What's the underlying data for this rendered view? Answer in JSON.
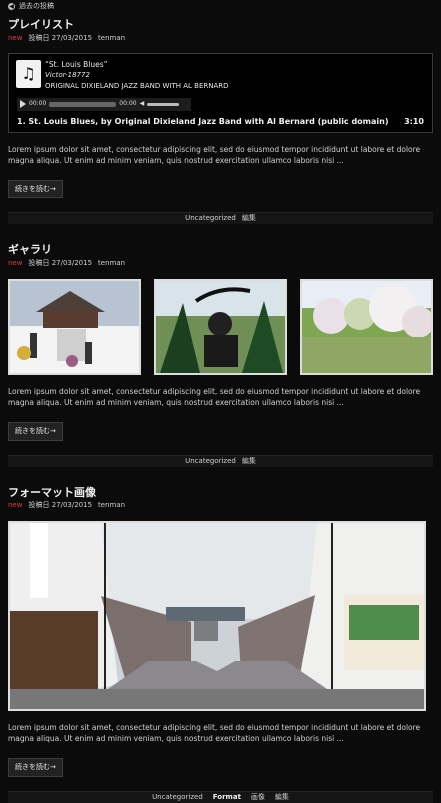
{
  "top": {
    "label": "過去の投稿"
  },
  "posts": [
    {
      "title": "プレイリスト",
      "new": "new",
      "date": "投稿日 27/03/2015",
      "author": "tenman",
      "playlist": {
        "title": "“St. Louis Blues”",
        "artist": "Victor-18772",
        "album": "ORIGINAL DIXIELAND JAZZ BAND WITH AL BERNARD",
        "time_current": "00:00",
        "time_total": "00:00",
        "track_line": "1. St. Louis Blues, by Original Dixieland Jazz Band with Al Bernard (public domain)",
        "duration": "3:10"
      },
      "excerpt": "Lorem ipsum dolor sit amet, consectetur adipiscing elit, sed do eiusmod tempor incididunt ut labore et dolore magna aliqua. Ut enim ad minim veniam, quis nostrud exercitation ullamco laboris nisi ...",
      "readmore": "続きを読む→",
      "category": "Uncategorized",
      "edit": "編集"
    },
    {
      "title": "ギャラリ",
      "new": "new",
      "date": "投稿日 27/03/2015",
      "author": "tenman",
      "excerpt": "Lorem ipsum dolor sit amet, consectetur adipiscing elit, sed do eiusmod tempor incididunt ut labore et dolore magna aliqua. Ut enim ad minim veniam, quis nostrud exercitation ullamco laboris nisi ...",
      "readmore": "続きを読む→",
      "category": "Uncategorized",
      "edit": "編集"
    },
    {
      "title": "フォーマット画像",
      "new": "new",
      "date": "投稿日 27/03/2015",
      "author": "tenman",
      "excerpt": "Lorem ipsum dolor sit amet, consectetur adipiscing elit, sed do eiusmod tempor incididunt ut labore et dolore magna aliqua. Ut enim ad minim veniam, quis nostrud exercitation ullamco laboris nisi ...",
      "readmore": "続きを読む→",
      "category": "Uncategorized",
      "format_label": "Format",
      "format_value": "画像",
      "edit": "編集"
    }
  ]
}
